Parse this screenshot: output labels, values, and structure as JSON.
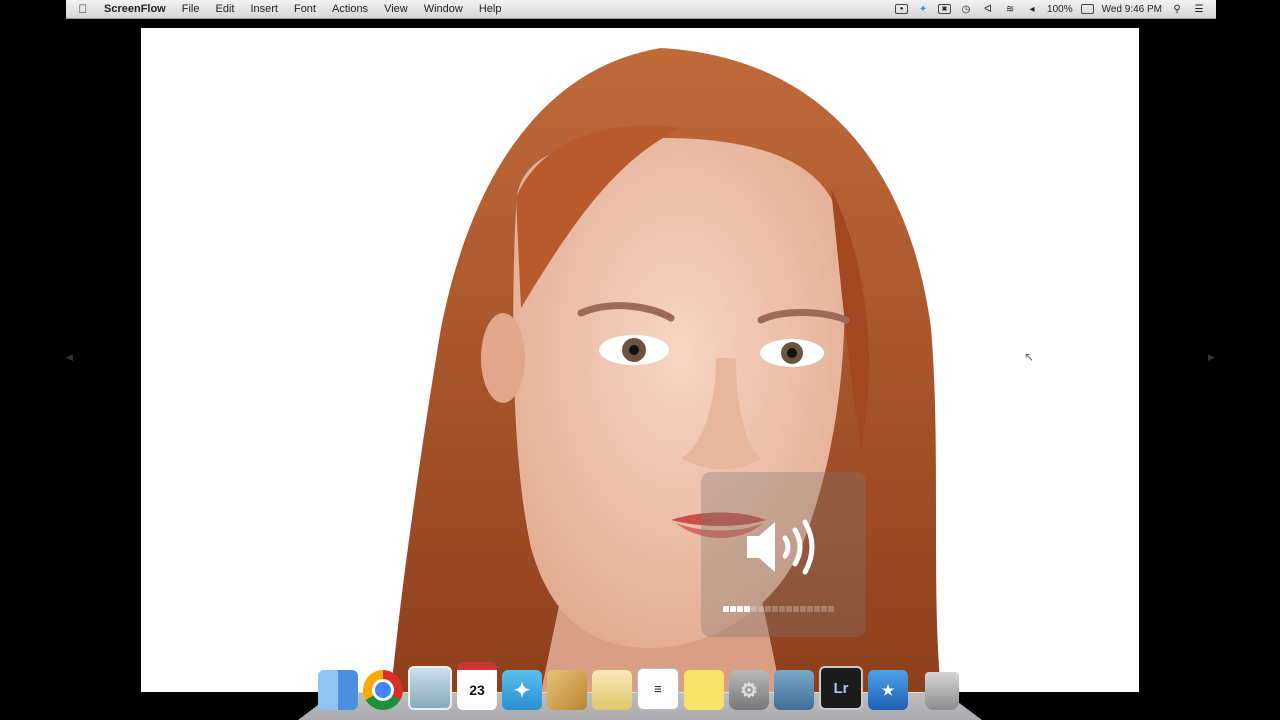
{
  "menubar": {
    "apple": "",
    "app_name": "ScreenFlow",
    "items": [
      "File",
      "Edit",
      "Insert",
      "Font",
      "Actions",
      "View",
      "Window",
      "Help"
    ],
    "battery": "100%",
    "clock": "Wed 9:46 PM",
    "status_icons": [
      "screenflow-icon",
      "twitter-icon",
      "box-icon",
      "timemachine-icon",
      "bluetooth-icon",
      "wifi-icon",
      "volume-icon",
      "battery-icon",
      "spotlight-icon",
      "notifications-icon"
    ]
  },
  "volume_hud": {
    "level": 0.25,
    "segments_total": 16,
    "segments_on": 4
  },
  "dock": {
    "calendar_day": "23",
    "lightroom_label": "Lr",
    "items": [
      "finder-icon",
      "chrome-icon",
      "preview-icon",
      "calendar-icon",
      "twitter-icon",
      "box-icon",
      "notes-icon",
      "textedit-icon",
      "stickies-icon",
      "system-preferences-icon",
      "iphoto-icon",
      "lightroom-icon",
      "imovie-icon",
      "trash-icon"
    ]
  },
  "colors": {
    "canvas_background": "#ffffff",
    "screen_background": "#000000",
    "hair": "#b4552a",
    "skin": "#f0c9b4"
  }
}
